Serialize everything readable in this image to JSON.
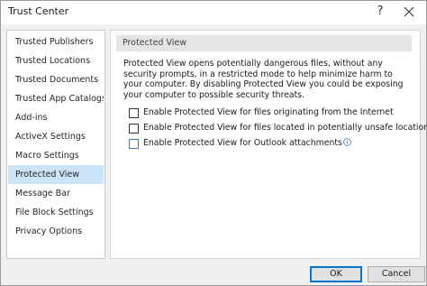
{
  "window": {
    "title": "Trust Center",
    "help_glyph": "?",
    "close_icon": "close-icon"
  },
  "sidebar": {
    "items": [
      {
        "label": "Trusted Publishers",
        "selected": false
      },
      {
        "label": "Trusted Locations",
        "selected": false
      },
      {
        "label": "Trusted Documents",
        "selected": false
      },
      {
        "label": "Trusted App Catalogs",
        "selected": false
      },
      {
        "label": "Add-ins",
        "selected": false
      },
      {
        "label": "ActiveX Settings",
        "selected": false
      },
      {
        "label": "Macro Settings",
        "selected": false
      },
      {
        "label": "Protected View",
        "selected": true
      },
      {
        "label": "Message Bar",
        "selected": false
      },
      {
        "label": "File Block Settings",
        "selected": false
      },
      {
        "label": "Privacy Options",
        "selected": false
      }
    ]
  },
  "main": {
    "section_title": "Protected View",
    "description": "Protected View opens potentially dangerous files, without any security prompts, in a restricted mode to help minimize harm to your computer. By disabling Protected View you could be exposing your computer to possible security threats.",
    "options": [
      {
        "label": "Enable Protected View for files originating from the Internet",
        "checked": false,
        "info_icon": false
      },
      {
        "label": "Enable Protected View for files located in potentially unsafe locations",
        "checked": false,
        "info_icon": true
      },
      {
        "label": "Enable Protected View for Outlook attachments",
        "checked": false,
        "info_icon": true
      }
    ]
  },
  "footer": {
    "ok_label": "OK",
    "cancel_label": "Cancel"
  },
  "colors": {
    "selection": "#cce4f7",
    "accent": "#0078d7",
    "info_icon": "#2b79d0"
  }
}
